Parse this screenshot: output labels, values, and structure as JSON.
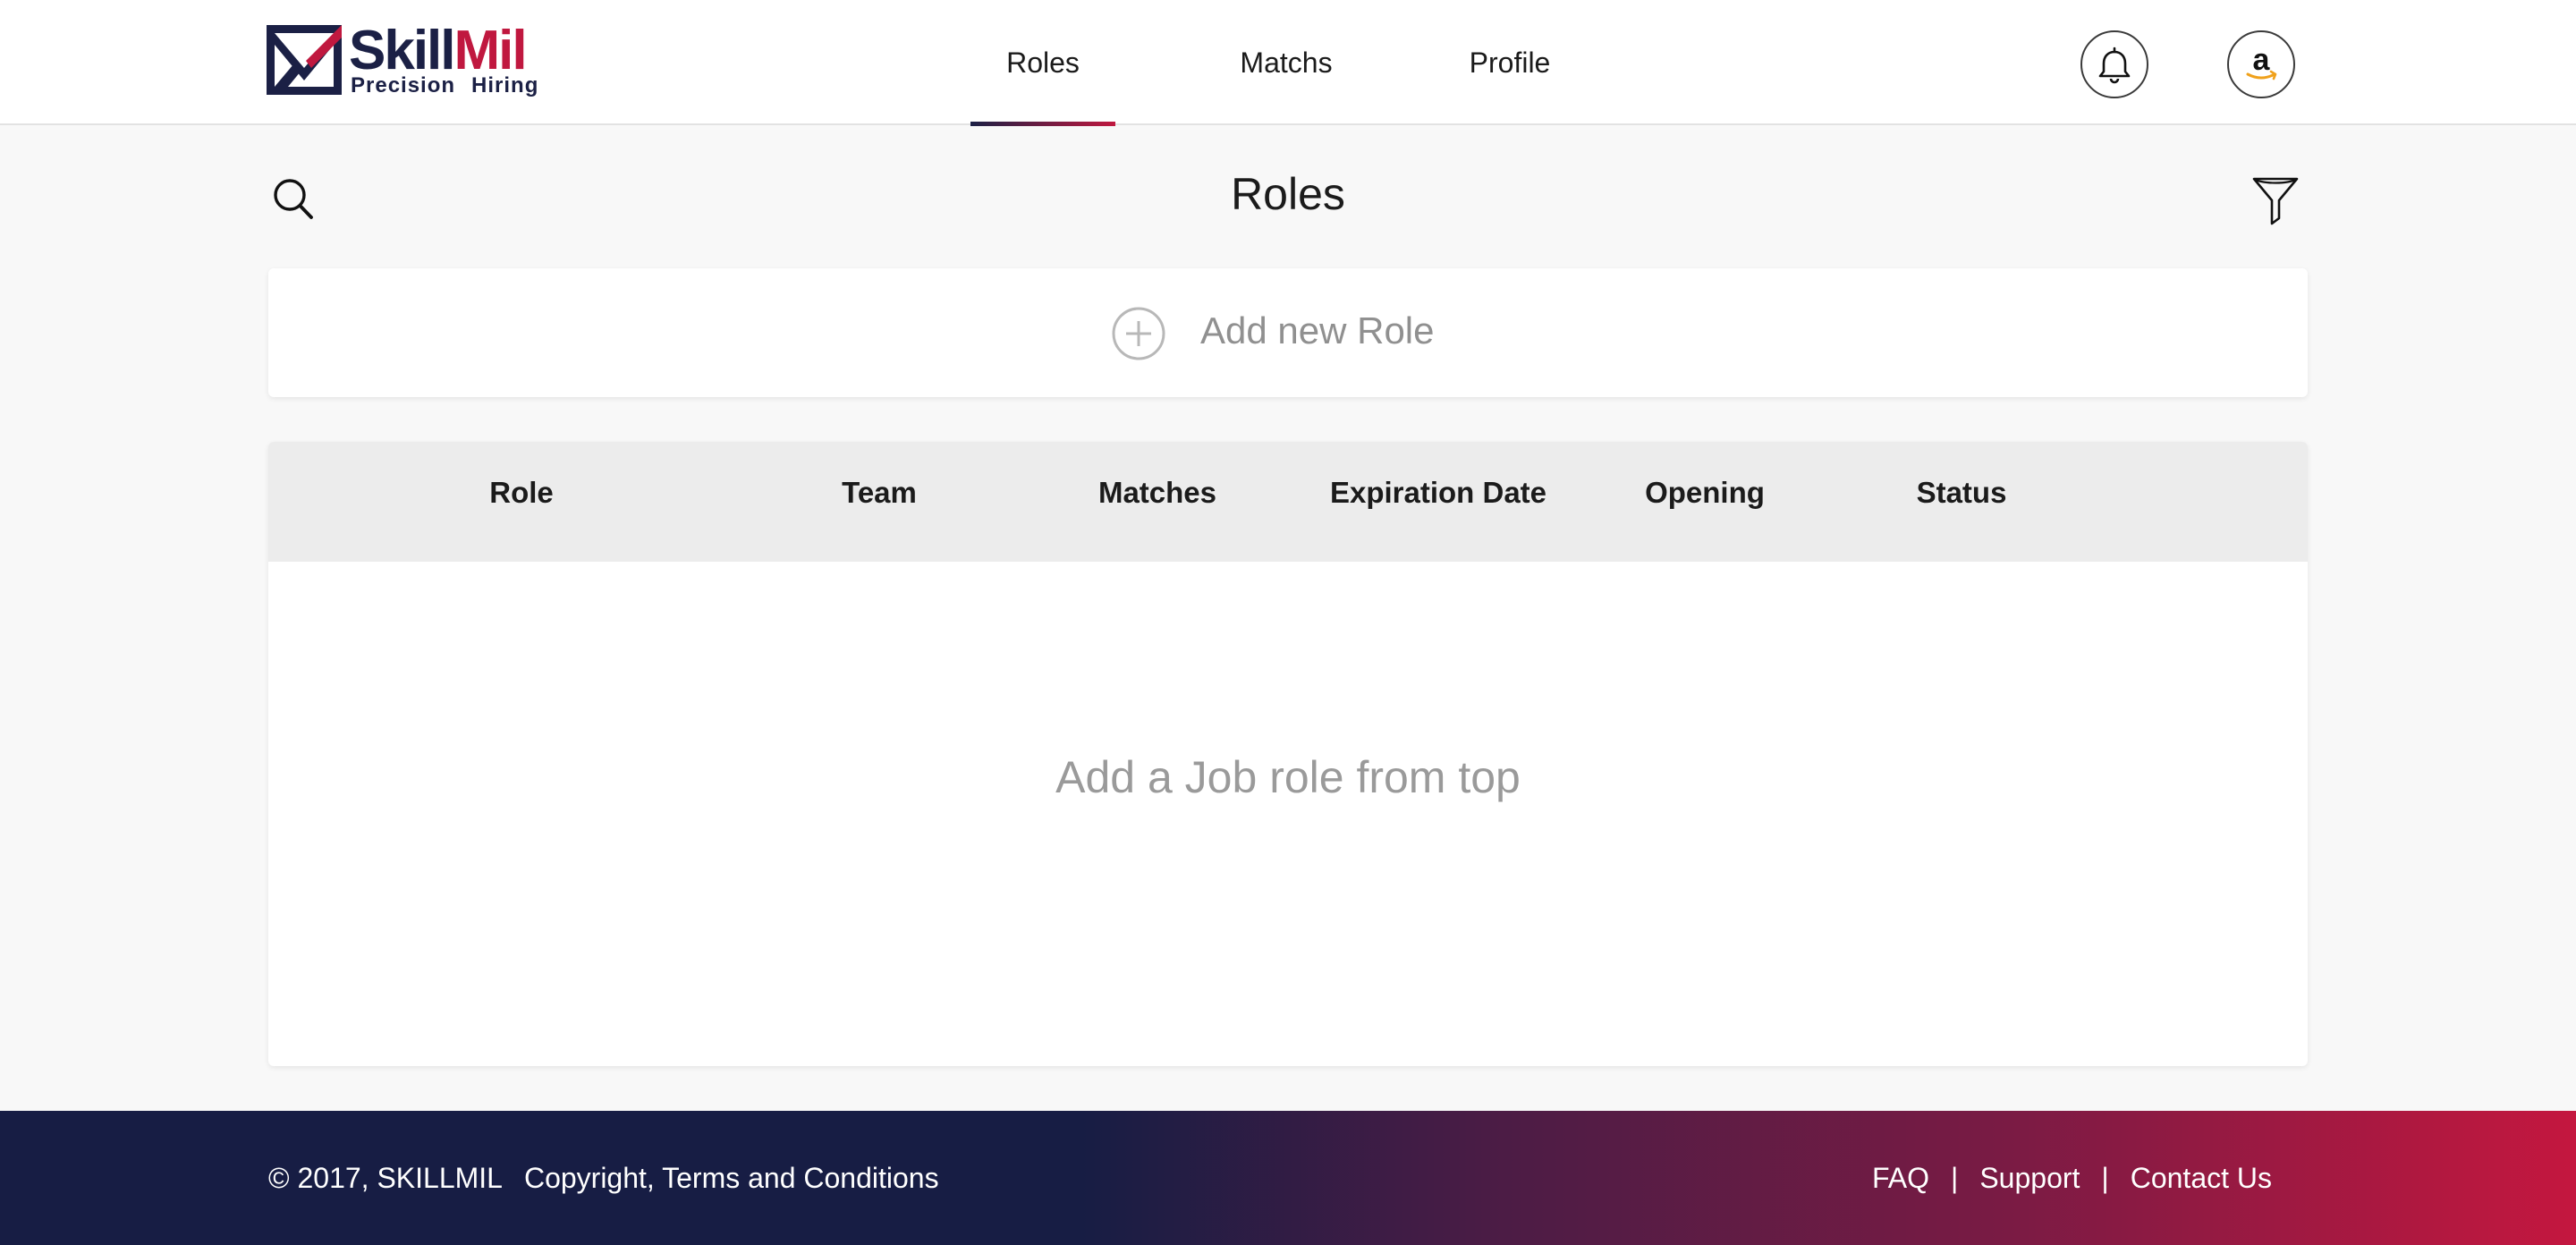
{
  "brand": {
    "name_part1": "Skill",
    "name_part2": "Mil",
    "tagline_1": "Precision",
    "tagline_2": "Hiring",
    "colors": {
      "navy": "#1b2045",
      "crimson": "#c0183f"
    }
  },
  "nav": {
    "tabs": [
      {
        "label": "Roles",
        "active": true
      },
      {
        "label": "Matchs",
        "active": false
      },
      {
        "label": "Profile",
        "active": false
      }
    ]
  },
  "header_actions": {
    "notification_icon": "bell-icon",
    "account_icon": "amazon-logo-avatar"
  },
  "toolbar": {
    "title": "Roles",
    "search_icon": "search-icon",
    "filter_icon": "filter-icon"
  },
  "add_role": {
    "label": "Add new Role",
    "icon": "plus-circle-icon"
  },
  "table": {
    "columns": [
      "Role",
      "Team",
      "Matches",
      "Expiration Date",
      "Opening",
      "Status"
    ],
    "rows": [],
    "empty_message": "Add a Job role from top"
  },
  "footer": {
    "copyright": "© 2017, SKILLMIL",
    "terms": "Copyright, Terms and Conditions",
    "links": [
      "FAQ",
      "Support",
      "Contact Us"
    ],
    "separator": "|"
  }
}
